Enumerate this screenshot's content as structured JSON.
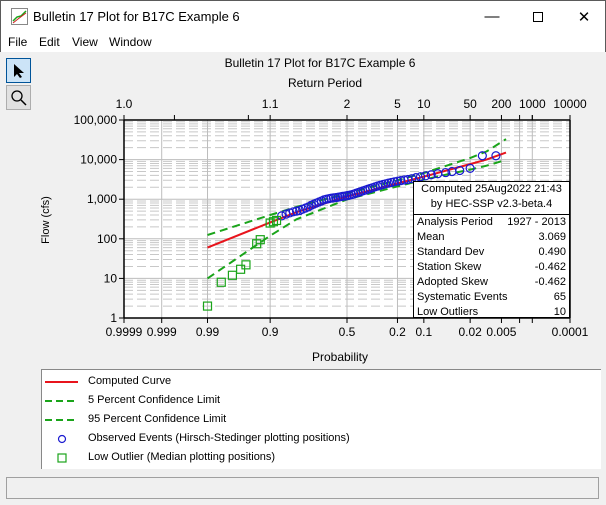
{
  "window": {
    "title": "Bulletin 17 Plot for B17C Example 6",
    "minimize_icon": "minimize-icon",
    "maximize_icon": "maximize-icon",
    "close_icon": "close-icon"
  },
  "menu": {
    "items": [
      "File",
      "Edit",
      "View",
      "Window"
    ]
  },
  "toolbar": {
    "tools": [
      {
        "name": "pointer-icon",
        "active": true
      },
      {
        "name": "zoom-magnifier-icon",
        "active": false
      }
    ]
  },
  "stats_box": {
    "header1": "Computed 25Aug2022 21:43",
    "header2": "by HEC-SSP v2.3-beta.4",
    "rows": [
      {
        "label": "Analysis Period",
        "value": "1927 - 2013"
      },
      {
        "label": "Mean",
        "value": "3.069"
      },
      {
        "label": "Standard Dev",
        "value": "0.490"
      },
      {
        "label": "Station Skew",
        "value": "-0.462"
      },
      {
        "label": "Adopted Skew",
        "value": "-0.462"
      },
      {
        "label": "Systematic Events",
        "value": "65"
      },
      {
        "label": "Low Outliers",
        "value": "10"
      }
    ]
  },
  "legend": [
    {
      "label": "Computed Curve",
      "style": "solid",
      "color": "#e8141c"
    },
    {
      "label": "5 Percent Confidence Limit",
      "style": "dashed",
      "color": "#1aa41a"
    },
    {
      "label": "95 Percent Confidence Limit",
      "style": "dashed",
      "color": "#1aa41a"
    },
    {
      "label": "Observed Events (Hirsch-Stedinger plotting positions)",
      "style": "circle",
      "color": "#1a1ad0"
    },
    {
      "label": "Low Outlier (Median plotting positions)",
      "style": "square",
      "color": "#1aa41a"
    }
  ],
  "chart_data": {
    "type": "scatter",
    "title": "Bulletin 17 Plot for B17C Example 6",
    "top_axis_label": "Return Period",
    "top_ticks": [
      {
        "label": "1.0",
        "p": 0.9999
      },
      {
        "label": "1.1",
        "p": 0.9
      },
      {
        "label": "2",
        "p": 0.5
      },
      {
        "label": "5",
        "p": 0.2
      },
      {
        "label": "10",
        "p": 0.1
      },
      {
        "label": "50",
        "p": 0.02
      },
      {
        "label": "200",
        "p": 0.005
      },
      {
        "label": "1000",
        "p": 0.001
      },
      {
        "label": "10000",
        "p": 0.0001
      }
    ],
    "xlabel": "Probability",
    "x_scale": "normal-probability",
    "x_ticks": [
      {
        "label": "0.9999",
        "p": 0.9999
      },
      {
        "label": "0.999",
        "p": 0.999
      },
      {
        "label": "0.99",
        "p": 0.99
      },
      {
        "label": "0.9",
        "p": 0.9
      },
      {
        "label": "0.5",
        "p": 0.5
      },
      {
        "label": "0.2",
        "p": 0.2
      },
      {
        "label": "0.1",
        "p": 0.1
      },
      {
        "label": "0.02",
        "p": 0.02
      },
      {
        "label": "0.005",
        "p": 0.005
      },
      {
        "label": "0.0001",
        "p": 0.0001
      }
    ],
    "x_minor_ticks": [
      0.002,
      0.001
    ],
    "xlim": [
      0.9999,
      0.0001
    ],
    "ylabel": "Flow (cfs)",
    "y_scale": "log",
    "ylim": [
      1,
      100000
    ],
    "y_ticks": [
      {
        "label": "100,000",
        "v": 100000
      },
      {
        "label": "10,000",
        "v": 10000
      },
      {
        "label": "1,000",
        "v": 1000
      },
      {
        "label": "100",
        "v": 100
      },
      {
        "label": "10",
        "v": 10
      },
      {
        "label": "1",
        "v": 1
      }
    ],
    "grid": true,
    "series": [
      {
        "name": "Computed Curve",
        "type": "line",
        "points": [
          [
            0.99,
            60
          ],
          [
            0.9,
            260
          ],
          [
            0.8,
            470
          ],
          [
            0.5,
            1170
          ],
          [
            0.2,
            2500
          ],
          [
            0.1,
            3700
          ],
          [
            0.04,
            5800
          ],
          [
            0.02,
            7700
          ],
          [
            0.01,
            10000
          ],
          [
            0.004,
            15000
          ]
        ]
      },
      {
        "name": "5 Percent Confidence Limit",
        "type": "line",
        "points": [
          [
            0.99,
            125
          ],
          [
            0.9,
            400
          ],
          [
            0.8,
            640
          ],
          [
            0.5,
            1400
          ],
          [
            0.2,
            3000
          ],
          [
            0.1,
            4600
          ],
          [
            0.04,
            7800
          ],
          [
            0.02,
            11000
          ],
          [
            0.01,
            16000
          ],
          [
            0.004,
            33000
          ]
        ]
      },
      {
        "name": "95 Percent Confidence Limit",
        "type": "line",
        "points": [
          [
            0.99,
            10
          ],
          [
            0.9,
            120
          ],
          [
            0.8,
            310
          ],
          [
            0.5,
            990
          ],
          [
            0.2,
            2100
          ],
          [
            0.1,
            3100
          ],
          [
            0.04,
            4500
          ],
          [
            0.02,
            5600
          ],
          [
            0.01,
            7000
          ],
          [
            0.004,
            9800
          ]
        ]
      },
      {
        "name": "Observed Events (Hirsch-Stedinger plotting positions)",
        "type": "scatter",
        "points": [
          [
            0.862,
            380
          ],
          [
            0.845,
            420
          ],
          [
            0.83,
            450
          ],
          [
            0.815,
            480
          ],
          [
            0.8,
            500
          ],
          [
            0.785,
            520
          ],
          [
            0.77,
            560
          ],
          [
            0.755,
            600
          ],
          [
            0.74,
            640
          ],
          [
            0.725,
            700
          ],
          [
            0.71,
            750
          ],
          [
            0.695,
            800
          ],
          [
            0.68,
            850
          ],
          [
            0.665,
            900
          ],
          [
            0.65,
            960
          ],
          [
            0.635,
            1000
          ],
          [
            0.62,
            1030
          ],
          [
            0.605,
            1060
          ],
          [
            0.59,
            1080
          ],
          [
            0.575,
            1100
          ],
          [
            0.56,
            1120
          ],
          [
            0.545,
            1150
          ],
          [
            0.53,
            1180
          ],
          [
            0.515,
            1200
          ],
          [
            0.5,
            1230
          ],
          [
            0.485,
            1260
          ],
          [
            0.47,
            1300
          ],
          [
            0.455,
            1350
          ],
          [
            0.44,
            1420
          ],
          [
            0.425,
            1480
          ],
          [
            0.41,
            1550
          ],
          [
            0.395,
            1620
          ],
          [
            0.38,
            1700
          ],
          [
            0.365,
            1780
          ],
          [
            0.35,
            1860
          ],
          [
            0.335,
            1950
          ],
          [
            0.32,
            2050
          ],
          [
            0.305,
            2150
          ],
          [
            0.29,
            2250
          ],
          [
            0.275,
            2350
          ],
          [
            0.26,
            2450
          ],
          [
            0.245,
            2550
          ],
          [
            0.23,
            2650
          ],
          [
            0.215,
            2750
          ],
          [
            0.2,
            2850
          ],
          [
            0.185,
            2950
          ],
          [
            0.17,
            3050
          ],
          [
            0.155,
            3150
          ],
          [
            0.14,
            3300
          ],
          [
            0.125,
            3500
          ],
          [
            0.11,
            3700
          ],
          [
            0.095,
            3900
          ],
          [
            0.08,
            4150
          ],
          [
            0.065,
            4400
          ],
          [
            0.05,
            4700
          ],
          [
            0.04,
            5000
          ],
          [
            0.03,
            5300
          ],
          [
            0.02,
            6000
          ],
          [
            0.012,
            12500
          ],
          [
            0.0065,
            12500
          ]
        ]
      },
      {
        "name": "Low Outlier (Median plotting positions)",
        "type": "scatter",
        "points": [
          [
            0.99,
            2
          ],
          [
            0.982,
            8
          ],
          [
            0.972,
            12
          ],
          [
            0.962,
            17
          ],
          [
            0.954,
            22
          ],
          [
            0.934,
            75
          ],
          [
            0.926,
            95
          ],
          [
            0.9,
            250
          ],
          [
            0.89,
            270
          ],
          [
            0.88,
            290
          ]
        ]
      }
    ]
  }
}
